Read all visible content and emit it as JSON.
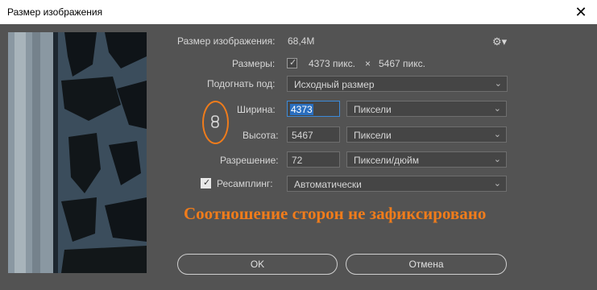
{
  "window": {
    "title": "Размер изображения",
    "close_glyph": "✕"
  },
  "info": {
    "image_size_label": "Размер изображения:",
    "image_size_value": "68,4M",
    "dimensions_label": "Размеры:",
    "dimensions_width": "4373 пикс.",
    "dimensions_separator": "×",
    "dimensions_height": "5467 пикс."
  },
  "fit_to": {
    "label": "Подогнать под:",
    "value": "Исходный размер"
  },
  "width": {
    "label": "Ширина:",
    "value": "4373",
    "unit": "Пиксели"
  },
  "height": {
    "label": "Высота:",
    "value": "5467",
    "unit": "Пиксели"
  },
  "resolution": {
    "label": "Разрешение:",
    "value": "72",
    "unit": "Пиксели/дюйм"
  },
  "resample": {
    "label": "Ресамплинг:",
    "checked": true,
    "method": "Автоматически"
  },
  "annotation": {
    "text": "Соотношение сторон не зафиксировано",
    "color": "#f07c1b"
  },
  "buttons": {
    "ok": "OK",
    "cancel": "Отмена"
  },
  "icons": {
    "settings": "gear-icon",
    "link": "chain-link-icon",
    "dropdown": "chevron-down-icon"
  }
}
